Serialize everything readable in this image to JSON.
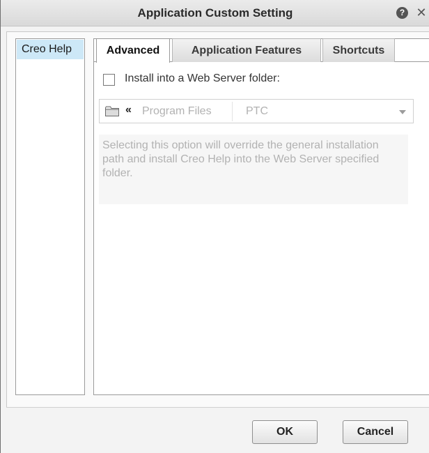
{
  "dialog": {
    "title": "Application Custom Setting",
    "help_glyph": "?",
    "close_glyph": "✕"
  },
  "sidebar": {
    "items": [
      {
        "label": "Creo Help",
        "selected": true
      }
    ]
  },
  "tabs": [
    {
      "label": "Advanced",
      "active": true
    },
    {
      "label": "Application Features",
      "active": false
    },
    {
      "label": "Shortcuts",
      "active": false
    }
  ],
  "advanced": {
    "checkbox_label": "Install into a Web Server folder:",
    "checked": false,
    "path": {
      "chevron": "«",
      "crumbs": [
        "Program Files",
        "PTC"
      ]
    },
    "description": "Selecting this option will override the general installation path and install Creo Help into the Web Server specified folder."
  },
  "buttons": {
    "ok": "OK",
    "cancel": "Cancel"
  },
  "icons": {
    "folder": "folder-icon",
    "help": "help-icon",
    "close": "close-icon",
    "dropdown": "chevron-down-icon"
  },
  "colors": {
    "selected_bg": "#cde8f7",
    "disabled_text": "#b2b2b2"
  }
}
